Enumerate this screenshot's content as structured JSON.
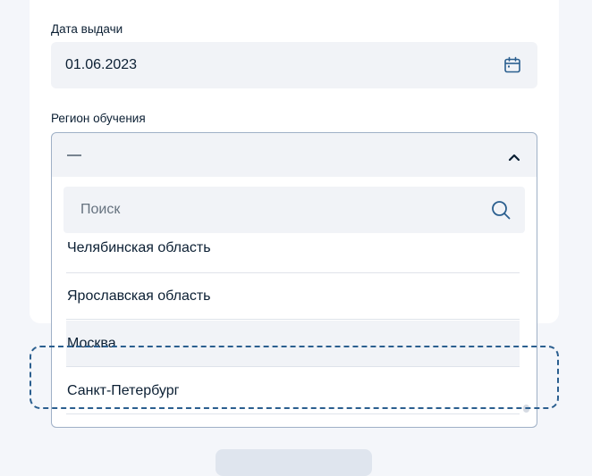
{
  "form": {
    "issue_date_label": "Дата выдачи",
    "issue_date_value": "01.06.2023",
    "region_label": "Регион обучения",
    "region_value": "—"
  },
  "dropdown": {
    "search_placeholder": "Поиск",
    "options": [
      "Челябинская область",
      "Ярославская область",
      "Москва",
      "Санкт-Петербург"
    ],
    "highlighted": "Москва"
  },
  "icons": {
    "calendar": "calendar-icon",
    "chevron": "chevron-up-icon",
    "search": "search-icon"
  },
  "colors": {
    "accent": "#2b5f8f",
    "field_bg": "#f1f3f7",
    "text": "#0b1f33"
  }
}
